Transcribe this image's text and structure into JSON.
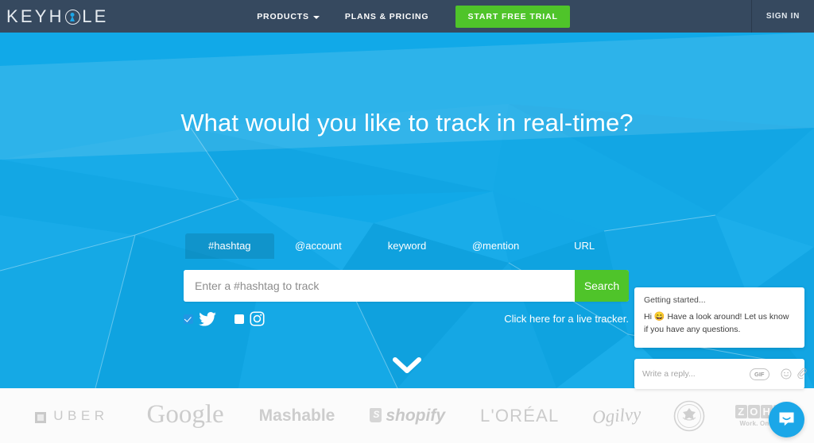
{
  "nav": {
    "brand": {
      "before": "KEYH",
      "after": "LE",
      "full": "KEYHOLE"
    },
    "links": [
      {
        "label": "PRODUCTS",
        "has_caret": true
      },
      {
        "label": "PLANS & PRICING",
        "has_caret": false
      }
    ],
    "cta_label": "START FREE TRIAL",
    "signin_label": "SIGN IN",
    "bg_color": "#36495f",
    "cta_color": "#4fc42a"
  },
  "hero": {
    "headline": "What would you like to track in real-time?",
    "bg_color": "#11a9e8",
    "tabs": [
      {
        "label": "#hashtag",
        "active": true
      },
      {
        "label": "@account",
        "active": false
      },
      {
        "label": "keyword",
        "active": false
      },
      {
        "label": "@mention",
        "active": false
      },
      {
        "label": "URL",
        "active": false
      }
    ],
    "search": {
      "placeholder": "Enter a #hashtag to track",
      "value": "",
      "button_label": "Search"
    },
    "networks": [
      {
        "name": "twitter",
        "checked": true
      },
      {
        "name": "instagram",
        "checked": false
      }
    ],
    "live_tracker_link": "Click here for a live tracker.",
    "scroll_hint_icon": "chevron-down-icon"
  },
  "logos": [
    {
      "name": "uber",
      "label": "UBER"
    },
    {
      "name": "google",
      "label": "Google"
    },
    {
      "name": "mashable",
      "label": "Mashable"
    },
    {
      "name": "shopify",
      "label": "shopify"
    },
    {
      "name": "loreal",
      "label": "L'ORÉAL"
    },
    {
      "name": "ogilvy",
      "label": "Ogilvy"
    },
    {
      "name": "us-government-seal",
      "label": ""
    },
    {
      "name": "zoho",
      "label": "ZOHO",
      "tagline": "Work. Online"
    }
  ],
  "chat": {
    "title": "Getting started...",
    "message_prefix": "Hi",
    "emoji": "😄",
    "message_body": "Have a look around! Let us know if you have any questions.",
    "reply_placeholder": "Write a reply...",
    "gif_label": "GIF",
    "accent_color": "#1ba7e8"
  }
}
